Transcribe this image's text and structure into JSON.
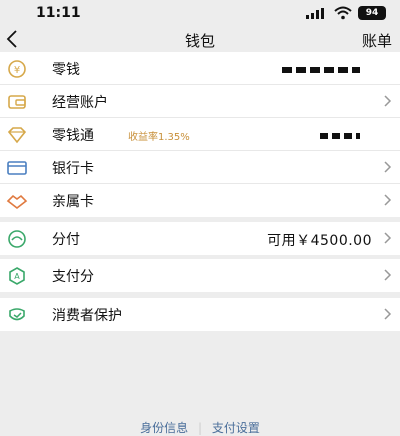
{
  "status": {
    "time": "11:11",
    "battery": "94"
  },
  "nav": {
    "title": "钱包",
    "right": "账单"
  },
  "group1": [
    {
      "label": "零钱"
    },
    {
      "label": "经营账户"
    },
    {
      "label": "零钱通",
      "sub": "收益率1.35%"
    },
    {
      "label": "银行卡"
    },
    {
      "label": "亲属卡"
    }
  ],
  "group2": {
    "label": "分付",
    "value": "可用￥4500.00"
  },
  "group3": {
    "label": "支付分"
  },
  "group4": {
    "label": "消费者保护"
  },
  "footer": {
    "left": "身份信息",
    "right": "支付设置"
  },
  "colors": {
    "gold": "#d6a84a",
    "blue": "#4a6e9a",
    "green": "#3aa86a"
  }
}
